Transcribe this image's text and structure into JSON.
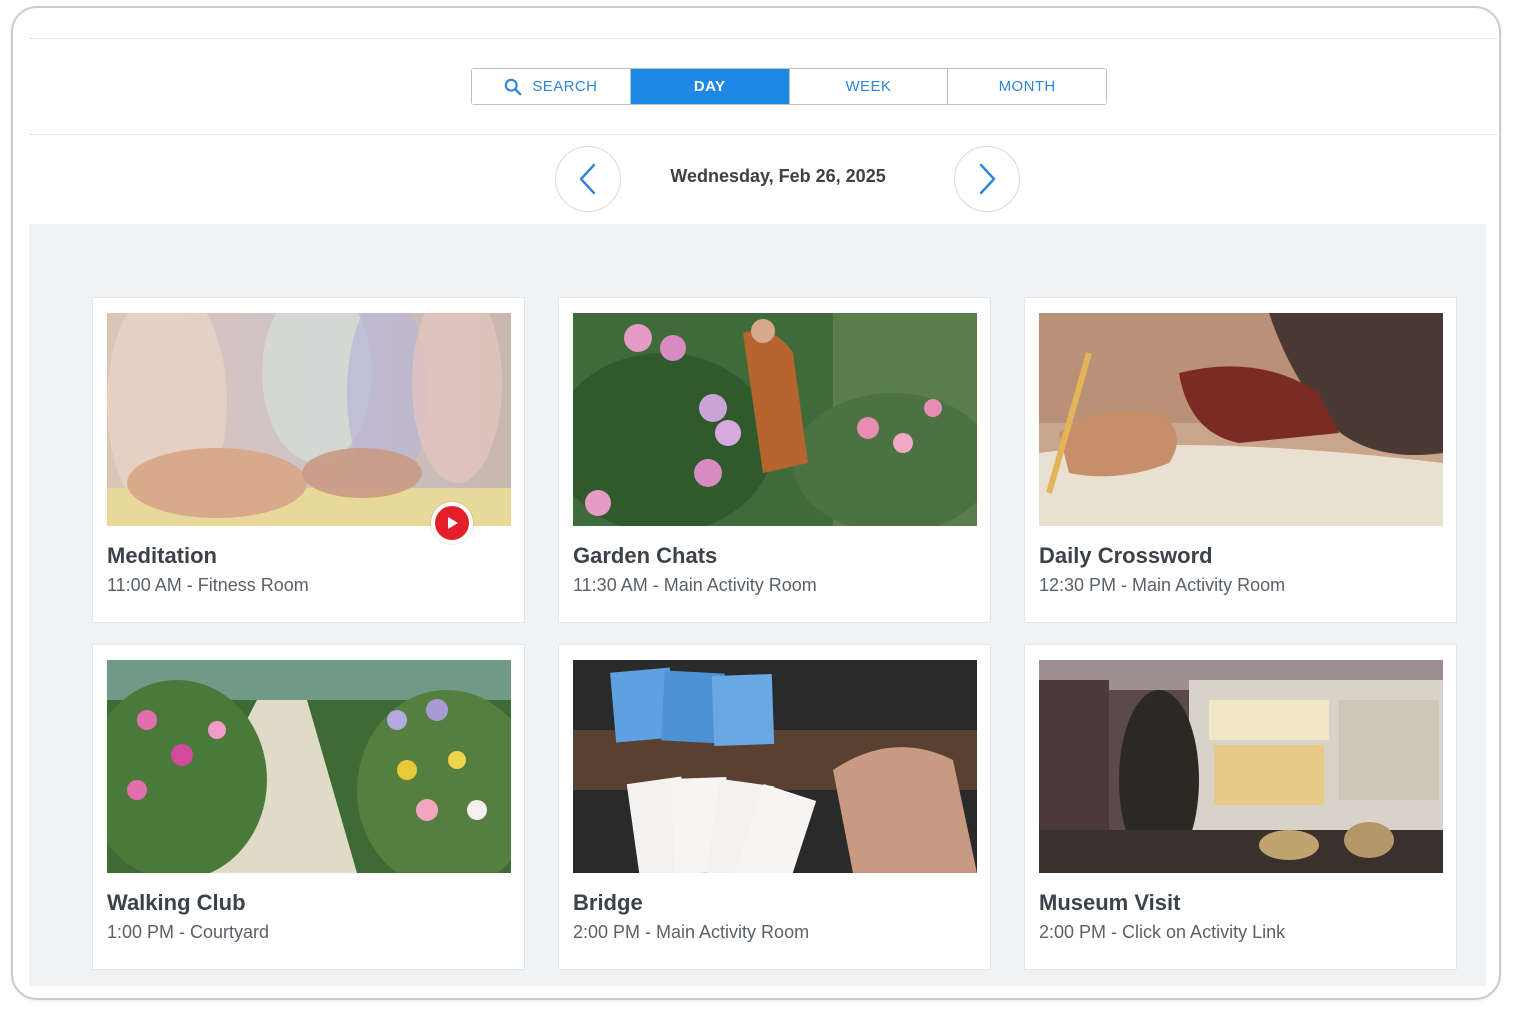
{
  "views": {
    "search_label": "SEARCH",
    "day_label": "DAY",
    "week_label": "WEEK",
    "month_label": "MONTH",
    "active": "DAY"
  },
  "date_nav": {
    "current_date": "Wednesday, Feb 26, 2025"
  },
  "activities": [
    {
      "title": "Meditation",
      "details": "11:00 AM - Fitness Room",
      "has_video": true
    },
    {
      "title": "Garden Chats",
      "details": "11:30 AM - Main Activity Room",
      "has_video": false
    },
    {
      "title": "Daily Crossword",
      "details": "12:30 PM - Main Activity Room",
      "has_video": false
    },
    {
      "title": "Walking Club",
      "details": "1:00 PM - Courtyard",
      "has_video": false
    },
    {
      "title": "Bridge",
      "details": "2:00 PM - Main Activity Room",
      "has_video": false
    },
    {
      "title": "Museum Visit",
      "details": "2:00 PM - Click on Activity Link",
      "has_video": false
    }
  ],
  "colors": {
    "accent": "#1e88e5",
    "play_badge": "#e3202a",
    "content_bg": "#f0f3f6"
  },
  "icons": {
    "search": "search-icon",
    "prev": "chevron-left-icon",
    "next": "chevron-right-icon",
    "video": "play-icon"
  }
}
